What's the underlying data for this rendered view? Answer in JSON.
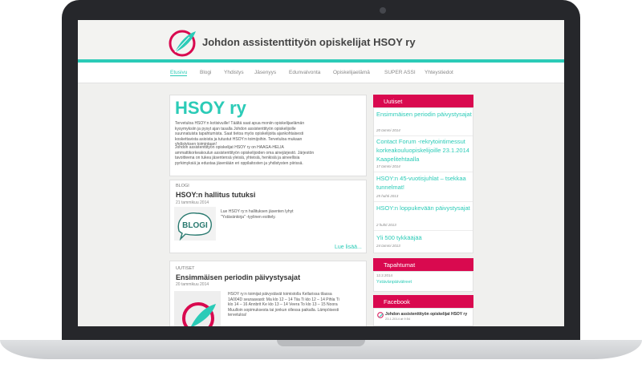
{
  "site": {
    "title": "Johdon assistenttityön opiskelijat HSOY ry"
  },
  "nav": {
    "items": [
      "Etusivu",
      "Blogi",
      "Yhdistys",
      "Jäsenyys",
      "Edunvalvonta",
      "Opiskelijaelämä",
      "SUPER ASSI",
      "Yhteystiedot"
    ],
    "active": "Etusivu"
  },
  "intro": {
    "title": "HSOY ry",
    "p1": "Tervetuloa HSOY:n kotisivuille! Täältä saat apua moniin opiskelijaelämän kysymyksiin ja pysyt ajan tasalla Johdon assistenttityön opiskelijoille suunnatuista tapahtumista. Saat tietoa myös opiskelijoita ajankohtaisesti koskettavista asioista ja tutustut HSOY:n toimijoihin. Tervetuloa mukaan yhdistyksen toimintaan!",
    "p2": "Johdon assistenttityön opiskelijat HSOY ry on HAAGA-HELIA ammattikorkeakoulun assistenttityön opiskelijoiden oma ainejärjestö. Järjestön tavoitteena on tukea jäsentensä yleisiä, yhteisiä, henkisiä ja aineellisia pyrkimyksiä ja edustaa jäseniään eri oppilaitosten ja yhdistysten piirissä."
  },
  "blog": {
    "section_label": "BLOGI",
    "post_title": "HSOY:n hallitus tutuksi",
    "post_date": "21 tammikuu 2014",
    "excerpt": "Lue HSOY ry:n hallituksen jäsenten lyhyt \"Ystävänkirja\" -tyylinen esittely.",
    "stamp_text": "BLOGI",
    "read_more": "Lue lisää..."
  },
  "news_post": {
    "section_label": "UUTISET",
    "post_title": "Ensimmäisen periodin päivystysajat",
    "post_date": "20 tammikuu 2014",
    "excerpt": "HSOY ry:n toimijat päivystävät toimistolla Kellarissa tilassa 1A004D seuraavasti: Ma klo 12 – 14 Tiia Ti klo 12 – 14 Pihla Ti klo 14 – 16 Annbrit Ke klo 13 – 14 Veera To klo 13 – 15 Noora Muulloin sopimuksesta tai jonkun ollessa paikalla. Lämpöisesti tervetuloa!"
  },
  "sidebar": {
    "news_heading": "Uutiset",
    "news": [
      {
        "title": "Ensimmäisen periodin päivystysajat",
        "date": "20 tammi 2014"
      },
      {
        "title": "Contact Forum -rekrytointimessut korkeakouluopiskelijoille 23.1.2014 Kaapelitehtaalla",
        "date": "17 tammi 2014"
      },
      {
        "title": "HSOY:n 45-vuotisjuhlat – tsekkaa tunnelmat!",
        "date": "25 huhti 2013"
      },
      {
        "title": "HSOY:n loppukevään päivystysajat",
        "date": "2 huhti 2013"
      },
      {
        "title": "Yli 500 tykkääjää",
        "date": "24 tammi 2013"
      }
    ],
    "events_heading": "Tapahtumat",
    "event_date": "12.2.2014",
    "event_title": "Ystävänpäivätreet",
    "facebook_heading": "Facebook",
    "facebook_page": "Johdon assistenttityön opiskelijat HSOY ry",
    "facebook_sub": "23.1.2014 at 9:54"
  },
  "colors": {
    "teal": "#2bcbb7",
    "crimson": "#d9094f",
    "frame": "#26272b"
  }
}
